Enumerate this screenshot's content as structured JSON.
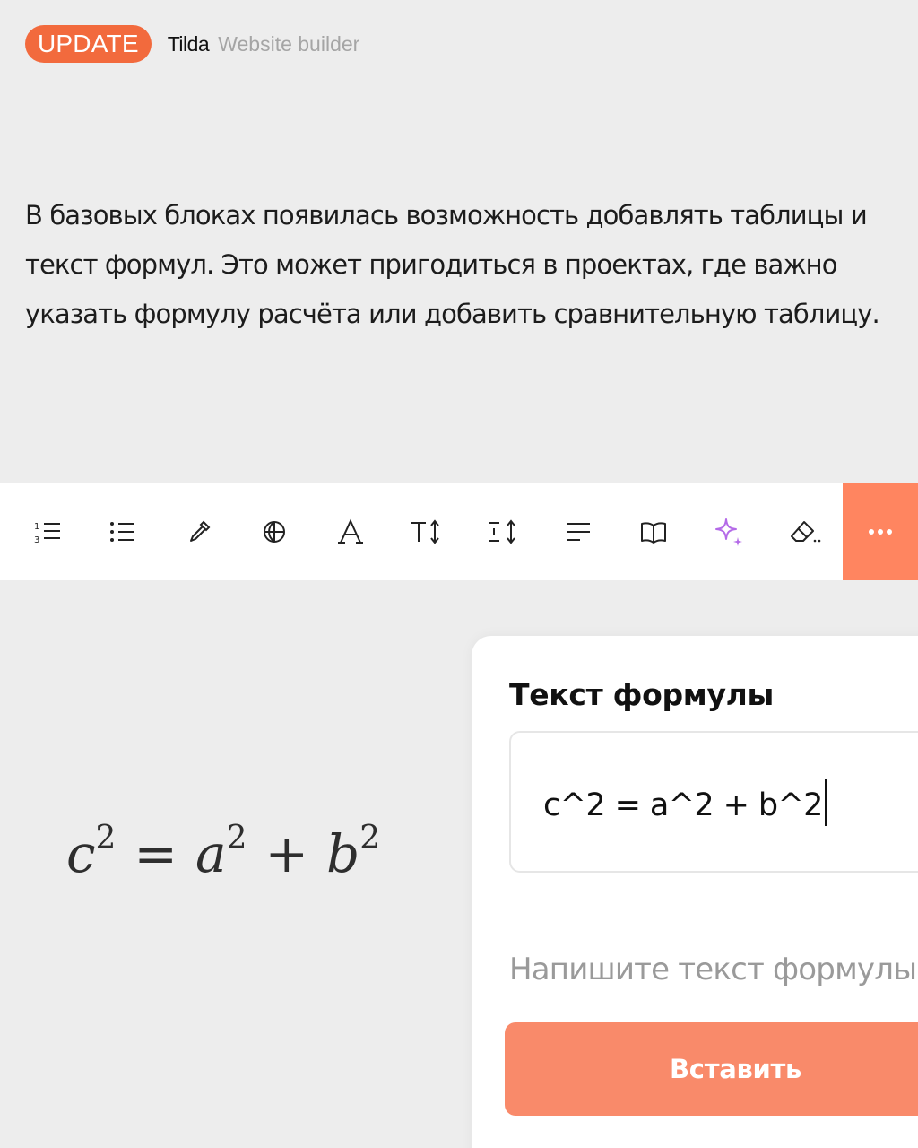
{
  "header": {
    "badge": "UPDATE",
    "brand": "Tilda",
    "subtitle": "Website builder"
  },
  "description": "В базовых блоках появилась возможность добавлять таблицы и текст формул. Это может пригодиться в проектах, где важно указать формулу расчёта или добавить сравнительную таблицу.",
  "toolbar": {
    "icons": [
      "ordered-list-icon",
      "bullet-list-icon",
      "eyedropper-icon",
      "globe-icon",
      "font-icon",
      "text-size-icon",
      "line-height-icon",
      "align-left-icon",
      "book-icon",
      "ai-sparkle-icon",
      "eraser-icon",
      "more-icon"
    ],
    "colors": {
      "more_button_bg": "#ff8560",
      "ai_icon": "#b46ae8"
    }
  },
  "preview": {
    "c": "c",
    "a": "a",
    "b": "b",
    "exp": "2",
    "eq": "=",
    "plus": "+"
  },
  "panel": {
    "title": "Текст формулы",
    "input_value": "c^2 = a^2 + b^2",
    "hint": "Напишите текст формулы",
    "insert_label": "Вставить"
  },
  "colors": {
    "accent": "#f26a3d",
    "button": "#f98a6a",
    "background": "#ededed"
  }
}
